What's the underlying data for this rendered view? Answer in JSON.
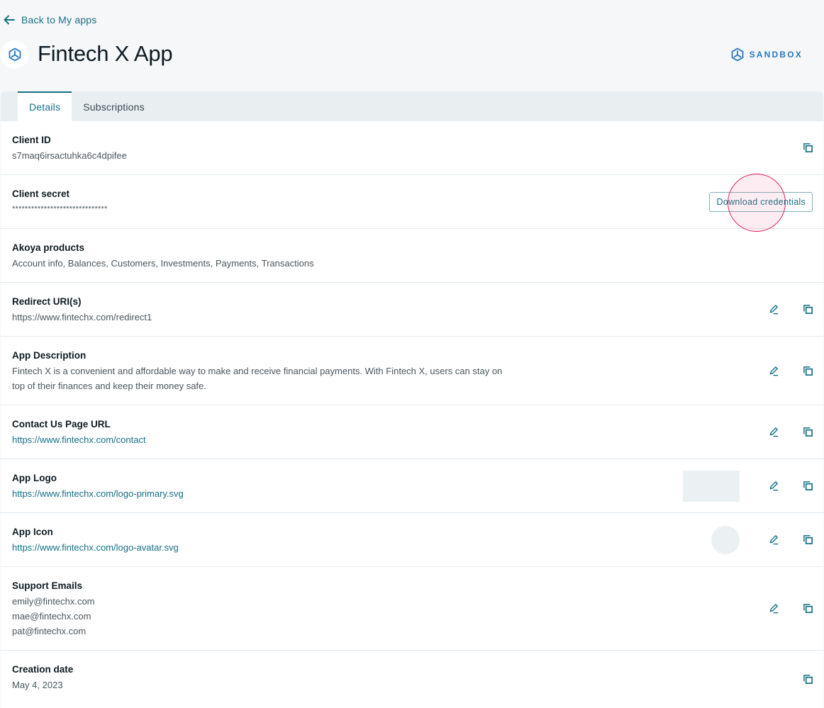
{
  "nav": {
    "back_label": "Back to My apps",
    "back_icon": "arrow-left-icon"
  },
  "header": {
    "title": "Fintech X App",
    "app_icon": "sandbox-hexagon-icon",
    "environment": "SANDBOX",
    "environment_color": "#2878c0"
  },
  "tabs": [
    {
      "label": "Details",
      "active": true
    },
    {
      "label": "Subscriptions",
      "active": false
    }
  ],
  "details": {
    "client_id": {
      "label": "Client ID",
      "value": "s7maq6irsactuhka6c4dpifee"
    },
    "client_secret": {
      "label": "Client secret",
      "value": "******************************",
      "button": "Download credentials"
    },
    "products": {
      "label": "Akoya products",
      "value": "Account info, Balances, Customers, Investments, Payments, Transactions"
    },
    "redirect": {
      "label": "Redirect URI(s)",
      "value": "https://www.fintechx.com/redirect1"
    },
    "description": {
      "label": "App Description",
      "value": "Fintech X is a convenient and affordable way to make and receive financial payments. With Fintech X, users can stay on top of their finances and keep their money safe."
    },
    "contact": {
      "label": "Contact Us Page URL",
      "value": "https://www.fintechx.com/contact"
    },
    "logo": {
      "label": "App Logo",
      "value": "https://www.fintechx.com/logo-primary.svg"
    },
    "icon": {
      "label": "App Icon",
      "value": "https://www.fintechx.com/logo-avatar.svg"
    },
    "emails": {
      "label": "Support Emails",
      "values": [
        "emily@fintechx.com",
        "mae@fintechx.com",
        "pat@fintechx.com"
      ]
    },
    "created": {
      "label": "Creation date",
      "value": "May 4, 2023"
    }
  },
  "colors": {
    "accent": "#166f86",
    "tab_bar": "#e9eef1",
    "page_bg": "#f6f7f9"
  }
}
